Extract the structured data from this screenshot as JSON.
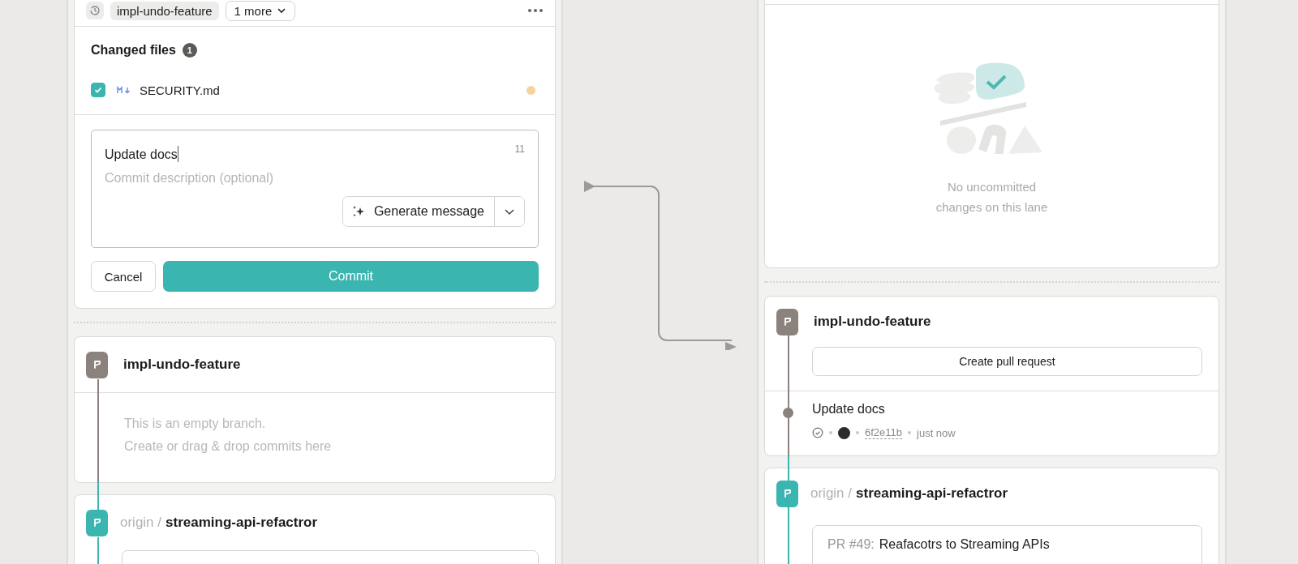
{
  "lanes": [
    {
      "header": {
        "branch_chip": "impl-undo-feature",
        "more_button": "1 more"
      },
      "changed_files": {
        "title": "Changed files",
        "count": "1",
        "files": [
          {
            "name": "SECURITY.md",
            "checked": true,
            "color": "#f5d39a"
          }
        ]
      },
      "commit_form": {
        "title": "Update docs",
        "char_count": "11",
        "description_placeholder": "Commit description (optional)",
        "generate_button": "Generate message",
        "cancel_button": "Cancel",
        "commit_button": "Commit"
      },
      "branches": [
        {
          "name": "impl-undo-feature",
          "color": "#8b827d",
          "empty_message": [
            "This is an empty branch.",
            "Create or drag & drop commits here"
          ]
        },
        {
          "remote": "origin /",
          "name": "streaming-api-refactror",
          "color": "#3bb5af",
          "pr_card_visible": true
        }
      ]
    },
    {
      "empty_state": {
        "message": "No uncommitted changes on this lane"
      },
      "branches": [
        {
          "name": "impl-undo-feature",
          "color": "#8b827d",
          "action_button": "Create pull request",
          "commits": [
            {
              "title": "Update docs",
              "hash": "6f2e11b",
              "time": "just now"
            }
          ]
        },
        {
          "remote": "origin /",
          "name": "streaming-api-refactror",
          "color": "#3bb5af",
          "pr": {
            "number": "PR #49:",
            "title": "Reafacotrs to Streaming APIs"
          }
        }
      ]
    }
  ]
}
